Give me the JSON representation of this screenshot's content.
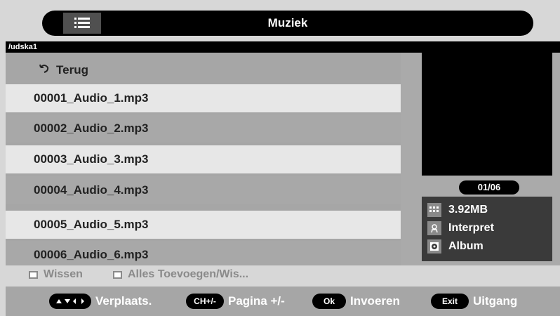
{
  "header": {
    "title": "Muziek",
    "menu_icon": "list-icon"
  },
  "path": "/udska1",
  "list": {
    "back_label": "Terug",
    "items": [
      "00001_Audio_1.mp3",
      "00002_Audio_2.mp3",
      "00003_Audio_3.mp3",
      "00004_Audio_4.mp3",
      "00005_Audio_5.mp3",
      "00006_Audio_6.mp3"
    ]
  },
  "info": {
    "counter": "01/06",
    "size": "3.92MB",
    "artist": "Interpret",
    "album": "Album",
    "icons": [
      "size-icon",
      "artist-icon",
      "album-icon"
    ]
  },
  "edit": {
    "clear": "Wissen",
    "add_all": "Alles Toevoegen/Wis..."
  },
  "hints": {
    "move": "Verplaats.",
    "page_key": "CH+/-",
    "page": "Pagina +/-",
    "ok_key": "Ok",
    "enter": "Invoeren",
    "exit_key": "Exit",
    "exit": "Uitgang"
  },
  "colors": {
    "accent": "#000000",
    "list_light": "#e7e7e7",
    "list_dark": "#a8a8a8",
    "panel": "#a6a6a6"
  }
}
